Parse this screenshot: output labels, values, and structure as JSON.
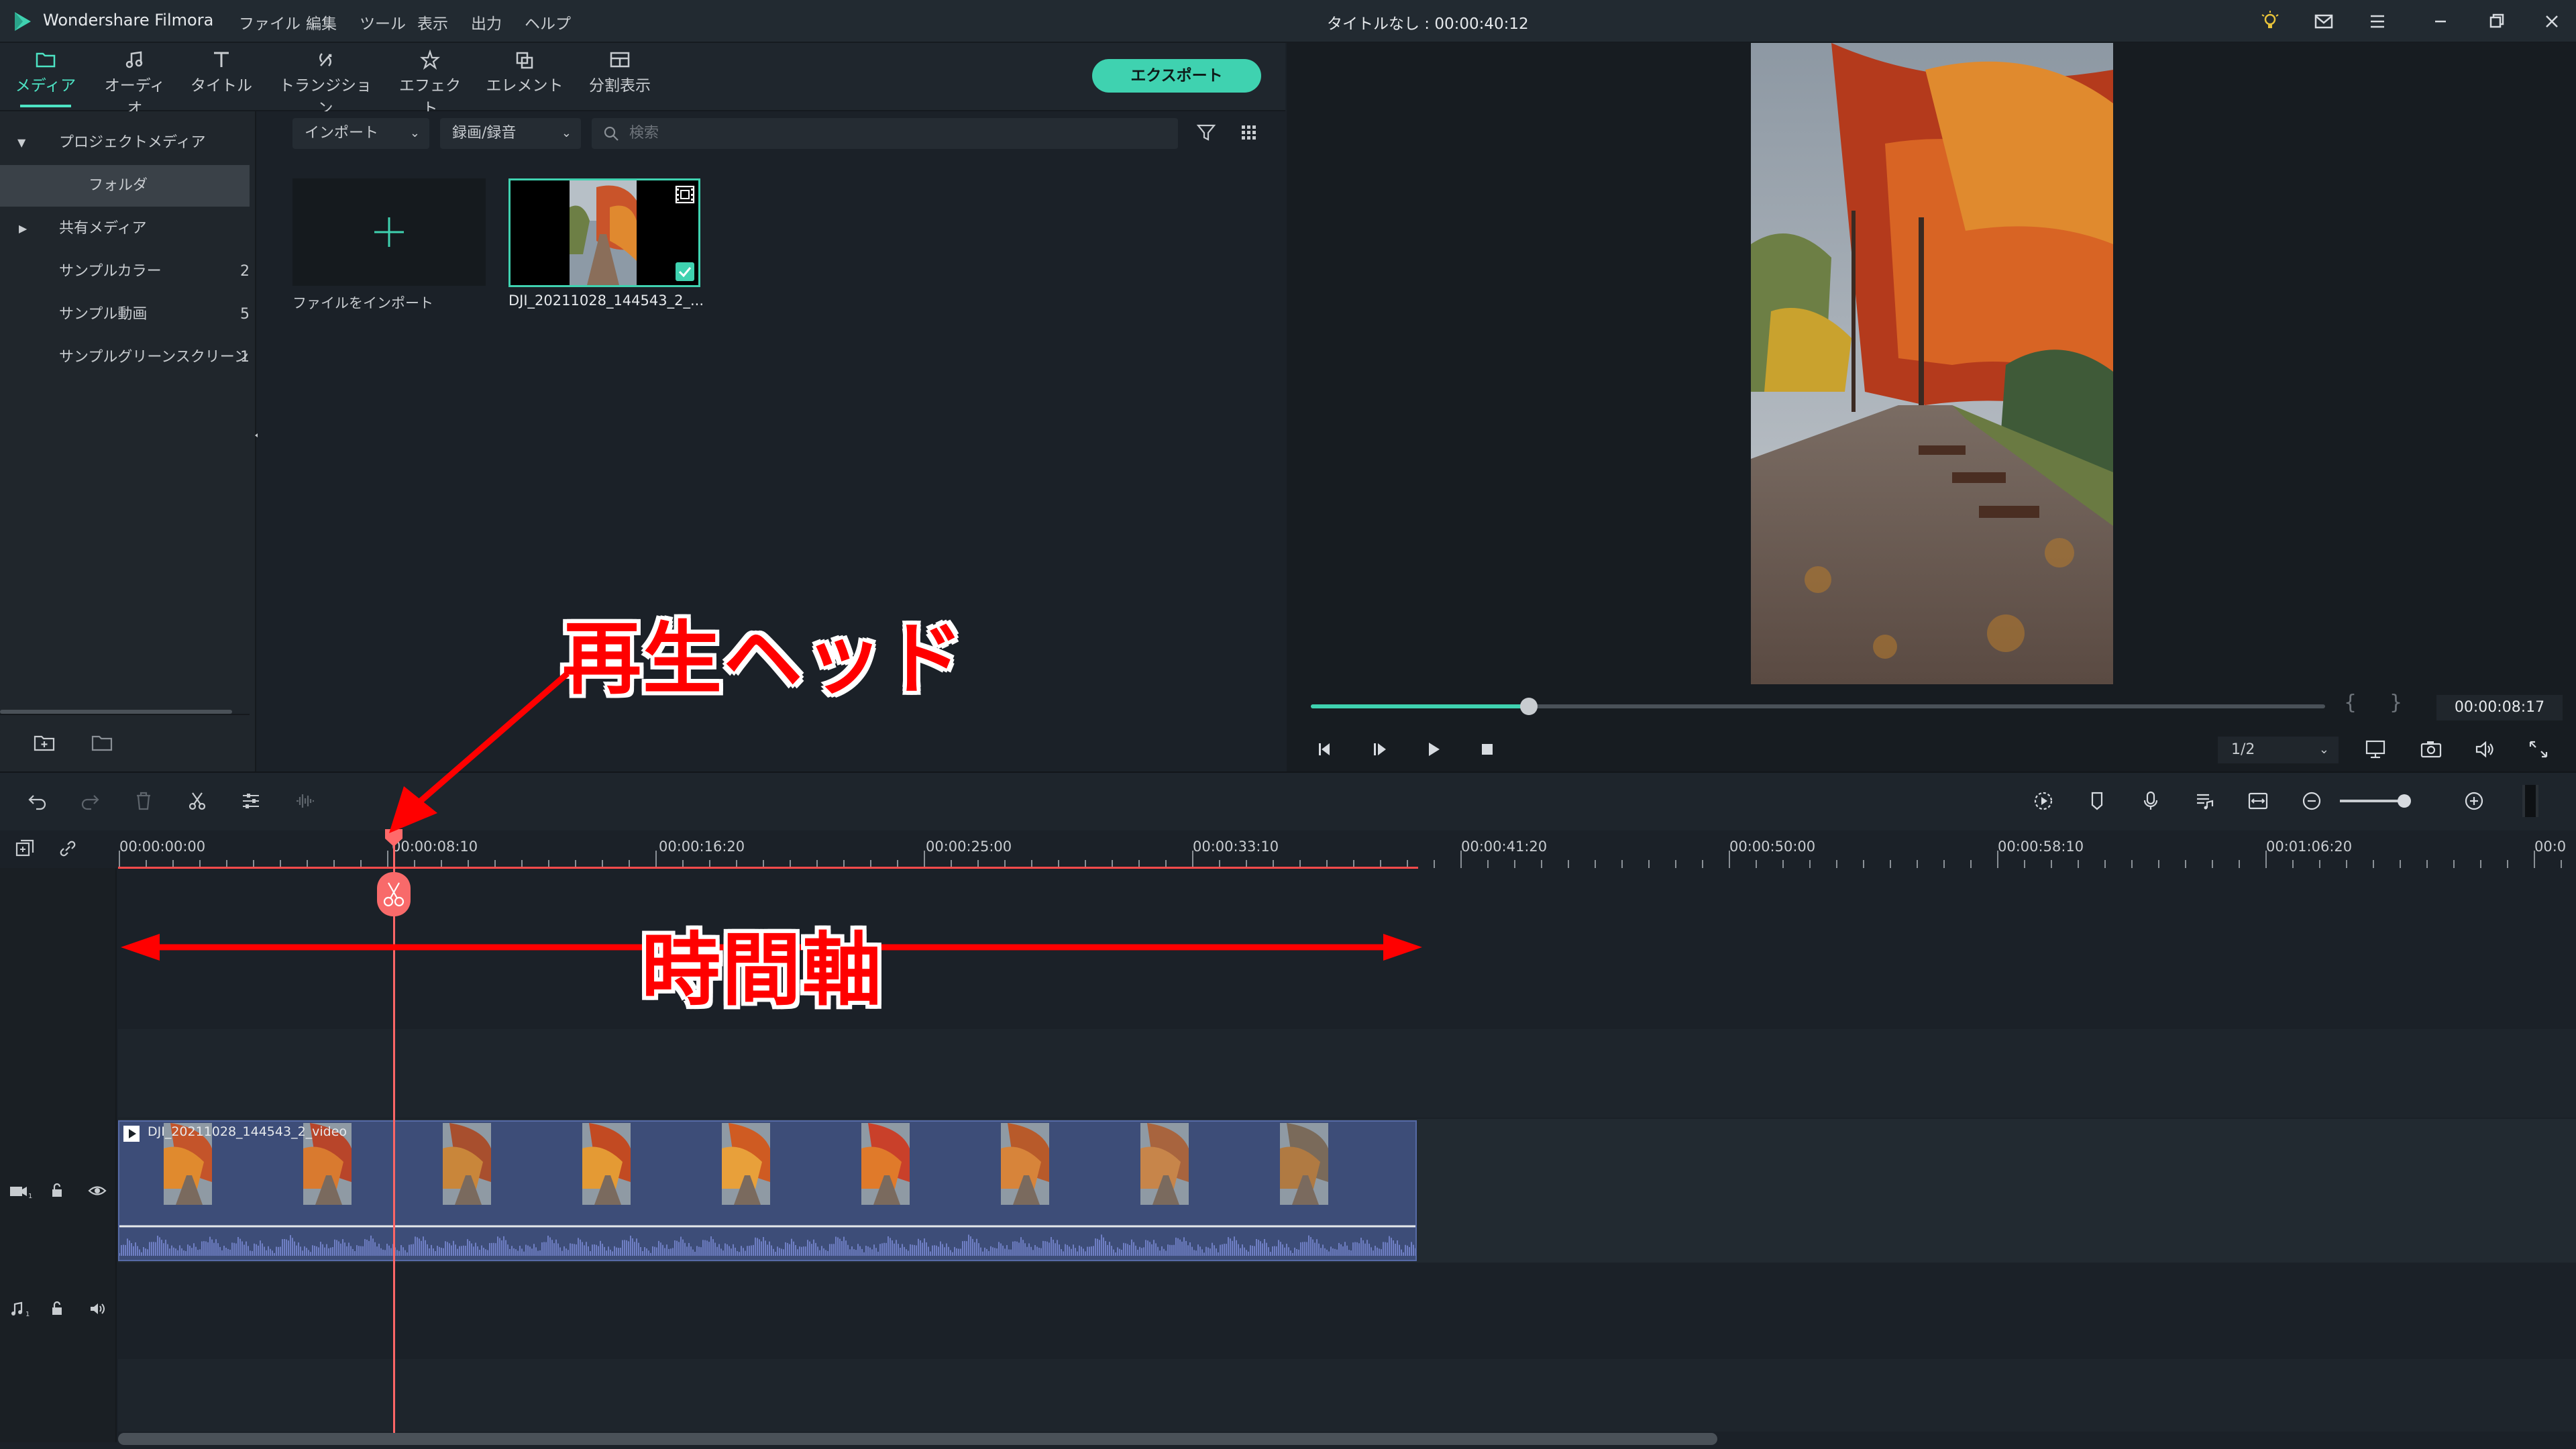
{
  "titlebar": {
    "app_name": "Wondershare Filmora",
    "menu": [
      "ファイル",
      "編集",
      "ツール",
      "表示",
      "出力",
      "ヘルプ"
    ],
    "doc_title": "タイトルなし : 00:00:40:12"
  },
  "tabs": [
    {
      "label": "メディア",
      "icon": "folder-icon",
      "active": true
    },
    {
      "label": "オーディオ",
      "icon": "music-note-icon",
      "active": false
    },
    {
      "label": "タイトル",
      "icon": "text-T-icon",
      "active": false
    },
    {
      "label": "トランジション",
      "icon": "transition-icon",
      "active": false
    },
    {
      "label": "エフェクト",
      "icon": "effect-star-icon",
      "active": false
    },
    {
      "label": "エレメント",
      "icon": "element-icon",
      "active": false
    },
    {
      "label": "分割表示",
      "icon": "split-screen-icon",
      "active": false
    }
  ],
  "export_label": "エクスポート",
  "sidebar": {
    "items": [
      {
        "label": "プロジェクトメディア",
        "count": ""
      },
      {
        "label": "フォルダ",
        "count": ""
      },
      {
        "label": "共有メディア",
        "count": ""
      },
      {
        "label": "サンプルカラー",
        "count": "2"
      },
      {
        "label": "サンプル動画",
        "count": "5"
      },
      {
        "label": "サンプルグリーンスクリーン",
        "count": "1"
      }
    ]
  },
  "media": {
    "import_dropdown": "インポート",
    "record_dropdown": "録画/録音",
    "search_placeholder": "検索",
    "import_tile_label": "ファイルをインポート",
    "clip_label": "DJI_20211028_144543_2_..."
  },
  "preview": {
    "time": "00:00:08:17",
    "ratio": "1/2",
    "progress": 0.17
  },
  "timeline": {
    "ruler_labels": [
      "00:00:00:00",
      "00:00:08:10",
      "00:00:16:20",
      "00:00:25:00",
      "00:00:33:10",
      "00:00:41:20",
      "00:00:50:00",
      "00:00:58:10",
      "00:01:06:20",
      "00:0"
    ],
    "clip_title": "DJI_20211028_144543_2_video"
  },
  "annotations": {
    "playhead": "再生ヘッド",
    "time_axis": "時間軸"
  },
  "colors": {
    "accent": "#3fd2b0",
    "playhead": "#ff6666",
    "annotation": "#ff0000"
  }
}
